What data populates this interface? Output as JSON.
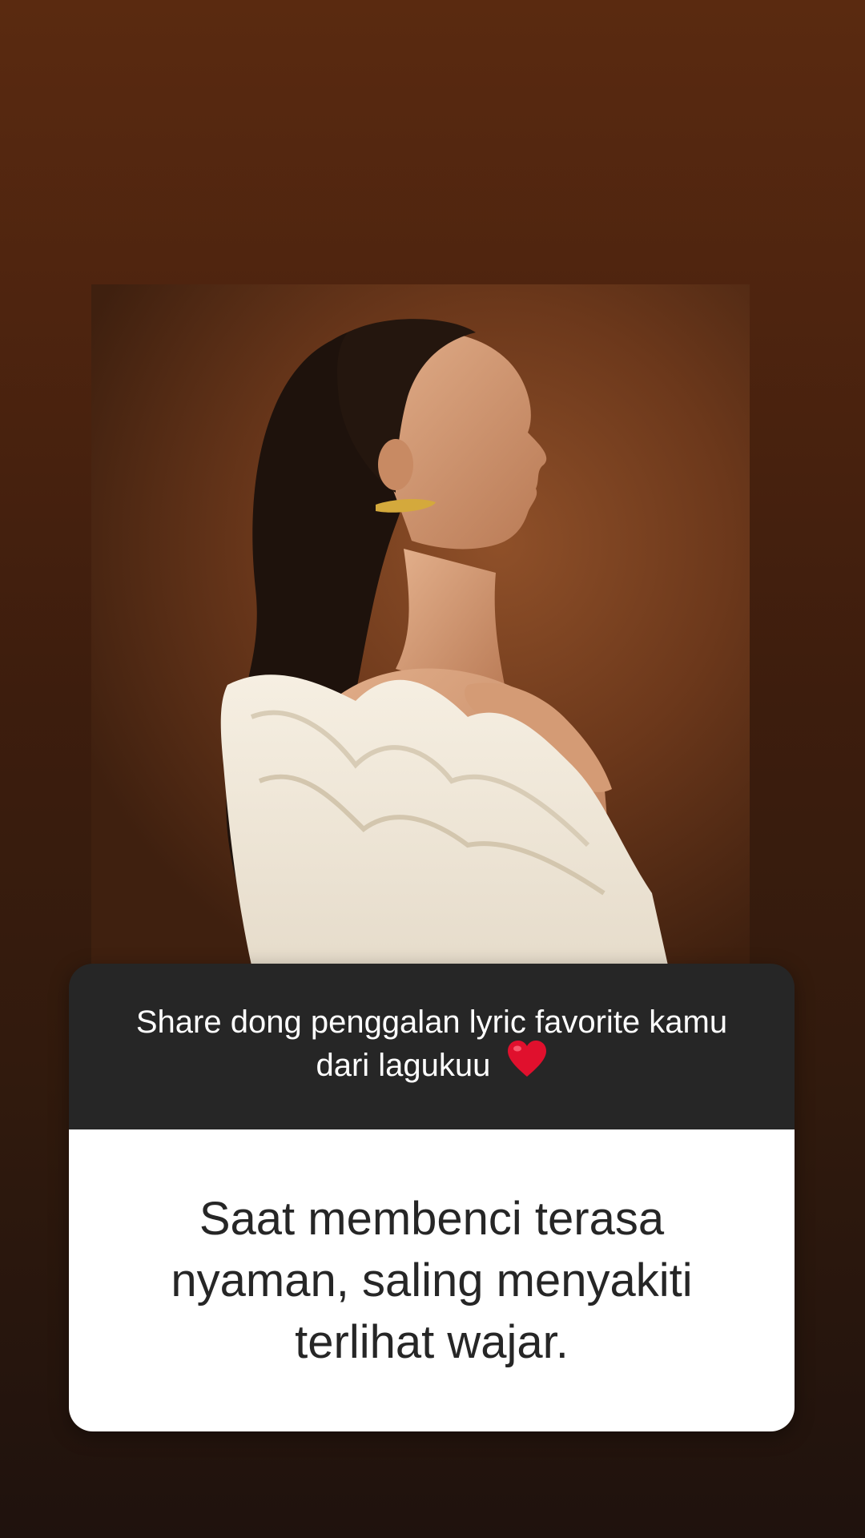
{
  "story": {
    "question_text": "Share dong penggalan lyric favorite kamu dari lagukuu",
    "question_emoji": "heart-emoji",
    "answer_text": "Saat membenci terasa nyaman, saling menyakiti terlihat wajar."
  },
  "colors": {
    "background_top": "#5a2a10",
    "background_bottom": "#1f120d",
    "question_bg": "#262626",
    "answer_bg": "#ffffff",
    "heart": "#e0102d"
  }
}
